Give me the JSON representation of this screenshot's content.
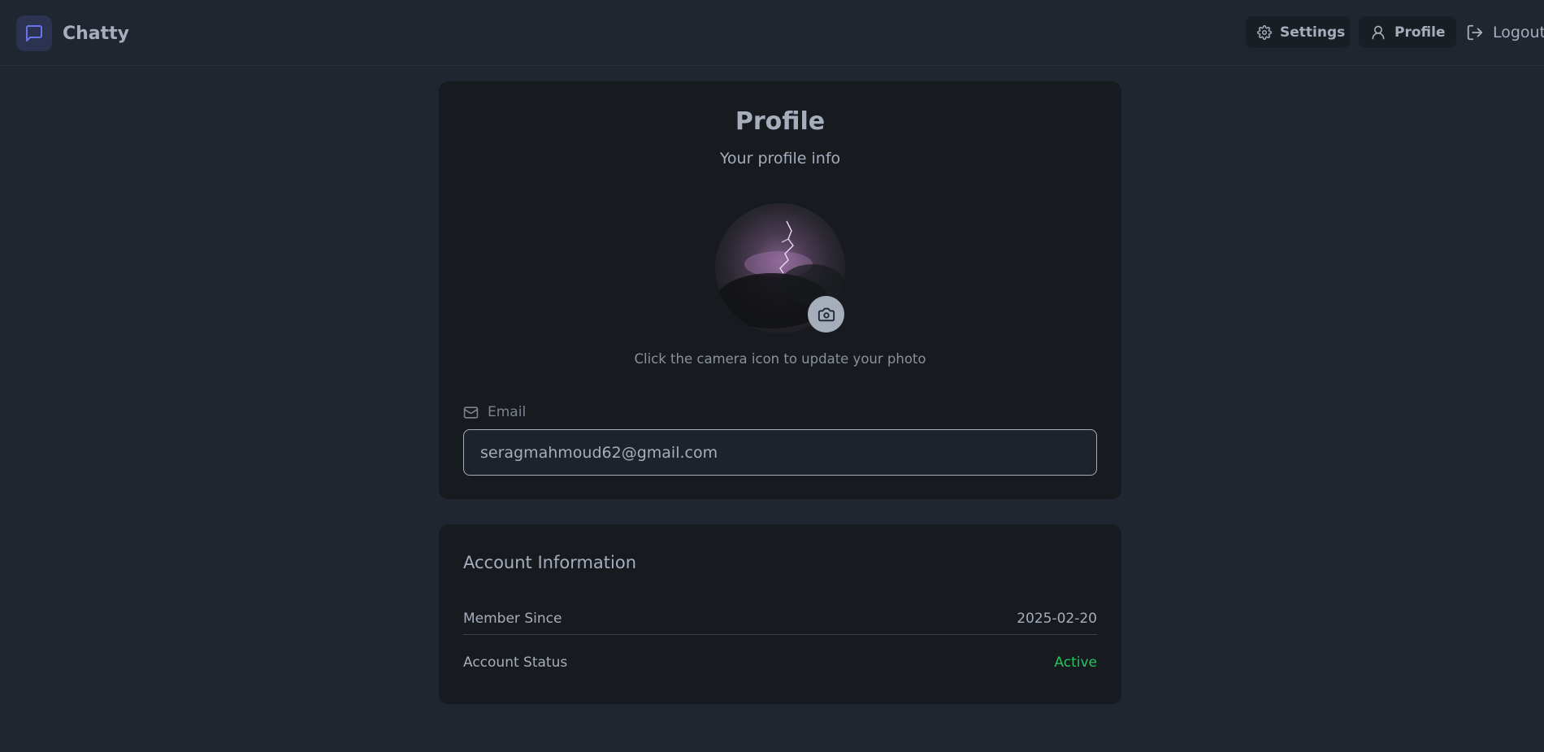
{
  "header": {
    "app_name": "Chatty",
    "nav": {
      "settings_label": "Settings",
      "profile_label": "Profile",
      "logout_label": "Logout"
    }
  },
  "profile_card": {
    "title": "Profile",
    "subtitle": "Your profile info",
    "photo_hint": "Click the camera icon to update your photo",
    "email_label": "Email",
    "email_value": "seragmahmoud62@gmail.com"
  },
  "account_card": {
    "title": "Account Information",
    "rows": [
      {
        "label": "Member Since",
        "value": "2025-02-20"
      },
      {
        "label": "Account Status",
        "value": "Active"
      }
    ]
  },
  "colors": {
    "background": "#1f2630",
    "card": "#171b20",
    "brand_accent": "#6a72f0",
    "status_active": "#22c55e"
  },
  "icons": {
    "brand": "message-square-icon",
    "settings": "gear-icon",
    "profile": "user-icon",
    "logout": "logout-icon",
    "camera": "camera-icon",
    "email": "mail-icon"
  }
}
